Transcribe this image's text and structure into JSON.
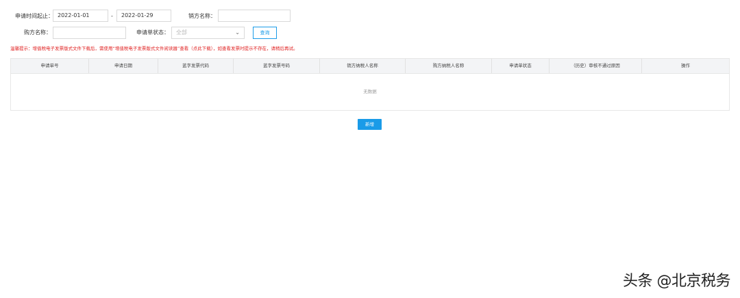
{
  "filters": {
    "date_label": "申请时间起止：",
    "date_start": "2022-01-01",
    "date_sep": "-",
    "date_end": "2022-01-29",
    "seller_label": "销方名称：",
    "seller_value": "",
    "buyer_label": "购方名称：",
    "buyer_value": "",
    "status_label": "申请单状态：",
    "status_selected": "全部",
    "search_button": "查询"
  },
  "notice": "温馨提示：增值税电子发票版式文件下载后，需使用“增值税电子发票版式文件阅读器”查看（点此下载），如查看发票时提示不存在，请稍后再试。",
  "table": {
    "columns": [
      "申请单号",
      "申请日期",
      "蓝字发票代码",
      "蓝字发票号码",
      "销方纳税人名称",
      "购方纳税人名称",
      "申请单状态",
      "（历史）审核不通过原因",
      "操作"
    ],
    "empty_text": "无数据"
  },
  "add_button": "新增",
  "watermark": "头条 @北京税务",
  "colors": {
    "accent": "#1a9be8",
    "notice": "#e02020",
    "header_bg": "#f3f4f6"
  }
}
